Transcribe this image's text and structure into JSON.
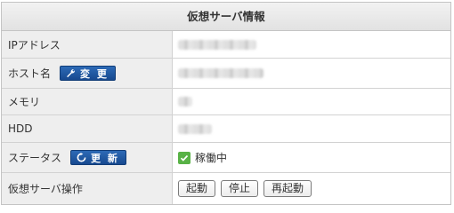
{
  "panel": {
    "title": "仮想サーバ情報"
  },
  "rows": {
    "ip": {
      "label": "IPアドレス"
    },
    "host": {
      "label": "ホスト名",
      "action_label": "変 更",
      "action_icon": "wrench-icon"
    },
    "memory": {
      "label": "メモリ"
    },
    "hdd": {
      "label": "HDD"
    },
    "status": {
      "label": "ステータス",
      "action_label": "更 新",
      "action_icon": "refresh-icon",
      "value": "稼働中"
    },
    "operations": {
      "label": "仮想サーバ操作",
      "buttons": [
        "起動",
        "停止",
        "再起動"
      ]
    }
  },
  "colors": {
    "header_bg": "#e6e6e6",
    "label_bg": "#eeeeee",
    "action_button": "#1f5aa6",
    "status_ok": "#58b246",
    "border": "#c4c4c4"
  }
}
